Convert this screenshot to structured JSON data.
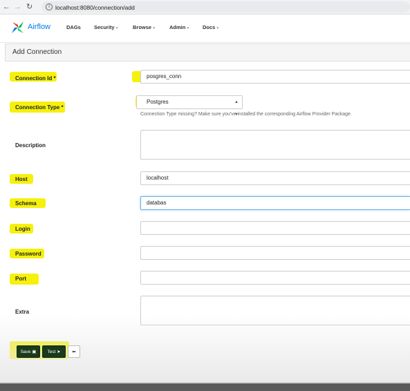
{
  "browser": {
    "url": "localhost:8080/connection/add"
  },
  "navbar": {
    "brand": "Airflow",
    "menu": [
      "DAGs",
      "Security",
      "Browse",
      "Admin",
      "Docs"
    ]
  },
  "form": {
    "title": "Add Connection",
    "fields": {
      "conn_id": {
        "label": "Connection Id *",
        "value": "posgres_conn"
      },
      "conn_type": {
        "label": "Connection Type *",
        "value": "Postgres",
        "help": "Connection Type missing? Make sure you've installed the corresponding Airflow Provider Package."
      },
      "description": {
        "label": "Description",
        "value": ""
      },
      "host": {
        "label": "Host",
        "value": "localhost"
      },
      "schema": {
        "label": "Schema",
        "value": "databas"
      },
      "login": {
        "label": "Login",
        "value": ""
      },
      "password": {
        "label": "Password",
        "value": ""
      },
      "port": {
        "label": "Port",
        "value": ""
      },
      "extra": {
        "label": "Extra",
        "value": ""
      }
    },
    "buttons": {
      "save": "Save",
      "test": "Test"
    }
  },
  "colors": {
    "highlight": "#f4f000",
    "accent": "#017cee",
    "button_dark": "#1a3a1a"
  }
}
